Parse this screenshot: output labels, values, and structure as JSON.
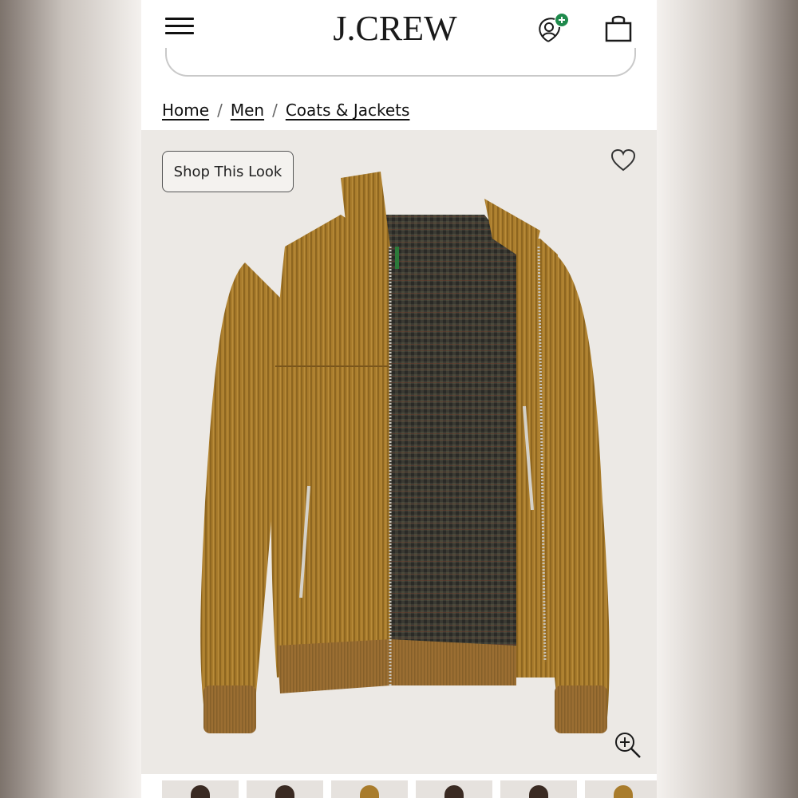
{
  "header": {
    "logo": "J.CREW",
    "menu_icon": "hamburger-menu-icon",
    "account_icon": "account-plus-icon",
    "bag_icon": "shopping-bag-icon",
    "accent_green": "#1f8a4c"
  },
  "breadcrumb": {
    "items": [
      "Home",
      "Men",
      "Coats & Jackets"
    ],
    "separator": "/"
  },
  "product": {
    "shop_look_label": "Shop This Look",
    "wishlist_icon": "heart-outline-icon",
    "zoom_icon": "zoom-in-icon",
    "image_icon": "corduroy-jacket-image",
    "colors": {
      "corduroy": "#a97c2c",
      "lining": "#3b3a33",
      "background": "#ece9e5"
    }
  },
  "thumbnails": {
    "count": 6
  }
}
